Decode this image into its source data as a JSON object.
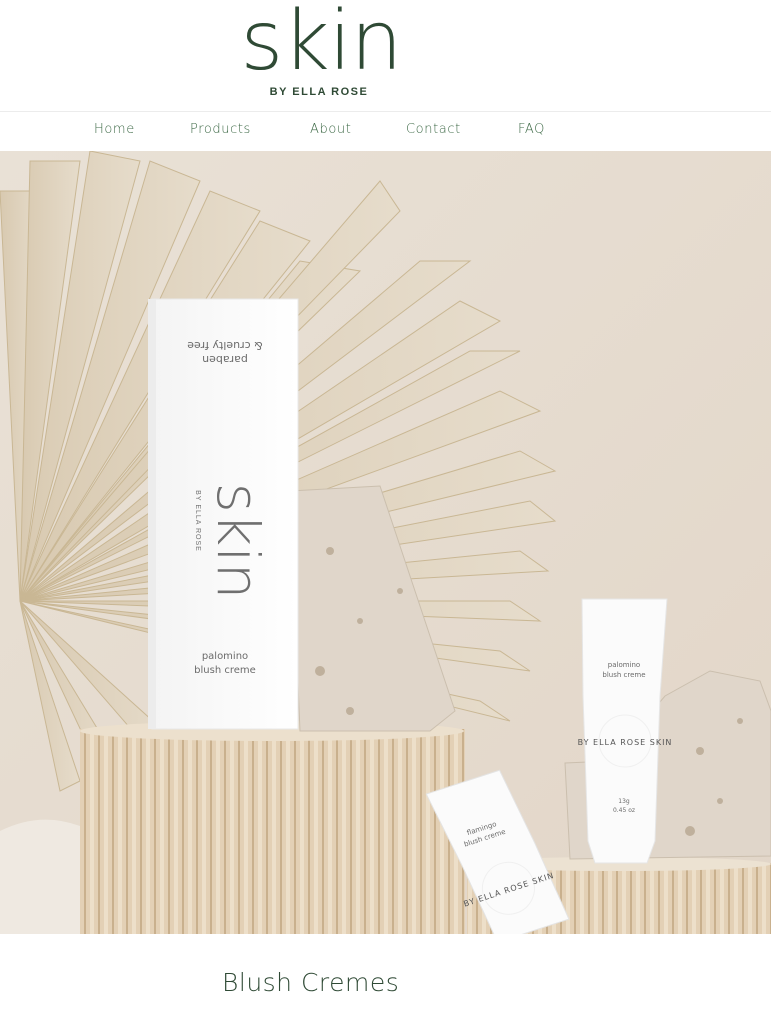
{
  "brand": {
    "logo_word": "skin",
    "logo_sub": "BY ELLA ROSE"
  },
  "nav": {
    "items": [
      "Home",
      "Products",
      "About",
      "Contact",
      "FAQ"
    ]
  },
  "hero": {
    "box": {
      "tagline_1": "paraben",
      "tagline_2": "& cruelty free",
      "word": "skin",
      "sub": "BY ELLA ROSE",
      "product_1": "palomino",
      "product_2": "blush creme"
    },
    "tube_right": {
      "product_1": "palomino",
      "product_2": "blush creme",
      "ring": "BY ELLA ROSE SKIN",
      "weight": "13g",
      "oz": "0.45 oz"
    },
    "tube_front": {
      "product_1": "flamingo",
      "product_2": "blush creme",
      "ring": "BY ELLA ROSE SKIN"
    }
  },
  "section": {
    "title": "Blush Cremes"
  },
  "colors": {
    "brand_green": "#2f4a35",
    "nav_green": "#3e6a47",
    "hero_bg": "#e7ddd2"
  }
}
